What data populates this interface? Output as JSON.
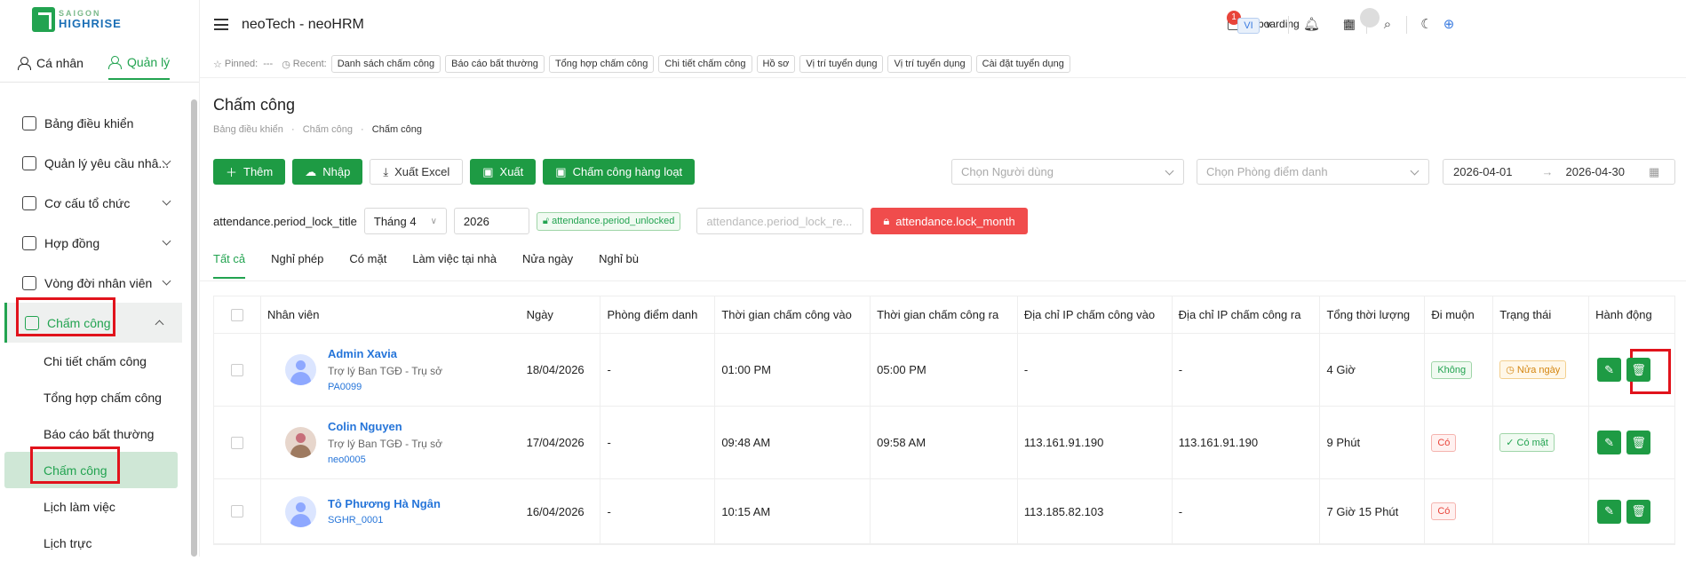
{
  "brand": {
    "line1": "SAIGON",
    "line2": "HIGHRISE"
  },
  "sidebar": {
    "user_tabs": [
      {
        "label": "Cá nhân",
        "active": false
      },
      {
        "label": "Quản lý",
        "active": true
      }
    ],
    "menu": [
      {
        "label": "Bảng điều khiển",
        "icon": "home-icon",
        "has_chevron": false
      },
      {
        "label": "Quản lý yêu cầu nhâ...",
        "icon": "checkbox-icon",
        "has_chevron": true
      },
      {
        "label": "Cơ cấu tổ chức",
        "icon": "org-chart-icon",
        "has_chevron": true
      },
      {
        "label": "Hợp đồng",
        "icon": "contract-icon",
        "has_chevron": true
      },
      {
        "label": "Vòng đời nhân viên",
        "icon": "lifecycle-icon",
        "has_chevron": true
      },
      {
        "label": "Chấm công",
        "icon": "attendance-icon",
        "has_chevron": true,
        "active": true
      }
    ],
    "submenu": [
      {
        "label": "Chi tiết chấm công"
      },
      {
        "label": "Tổng hợp chấm công"
      },
      {
        "label": "Báo cáo bất thường"
      },
      {
        "label": "Chấm công",
        "active": true
      },
      {
        "label": "Lịch làm việc"
      },
      {
        "label": "Lịch trực"
      }
    ]
  },
  "header": {
    "title": "neoTech - neoHRM",
    "onboarding": {
      "label": "Onboarding",
      "badge": "1"
    },
    "lang": "VI"
  },
  "pinbar": {
    "pinned_label": "Pinned:",
    "pinned_value": "---",
    "recent_label": "Recent:",
    "recent_items": [
      "Danh sách chấm công",
      "Báo cáo bất thường",
      "Tổng hợp chấm công",
      "Chi tiết chấm công",
      "Hồ sơ",
      "Vị trí tuyển dụng",
      "Vị trí tuyển dụng",
      "Cài đặt tuyển dụng"
    ]
  },
  "page": {
    "title": "Chấm công",
    "breadcrumb": [
      "Bảng điều khiển",
      "Chấm công",
      "Chấm công"
    ]
  },
  "toolbar": {
    "add": "Thêm",
    "import": "Nhập",
    "export_excel": "Xuất Excel",
    "export": "Xuất",
    "bulk": "Chấm công hàng loạt",
    "user_placeholder": "Chọn Người dùng",
    "room_placeholder": "Chọn Phòng điểm danh",
    "date_from": "2026-04-01",
    "date_to": "2026-04-30"
  },
  "lock": {
    "title": "attendance.period_lock_title",
    "month": "Tháng 4",
    "year": "2026",
    "status": "attendance.period_unlocked",
    "reason_placeholder": "attendance.period_lock_re...",
    "lock_button": "attendance.lock_month"
  },
  "tabs": [
    "Tất cả",
    "Nghỉ phép",
    "Có mặt",
    "Làm việc tại nhà",
    "Nửa ngày",
    "Nghỉ bù"
  ],
  "table": {
    "headers": [
      "Nhân viên",
      "Ngày",
      "Phòng điểm danh",
      "Thời gian chấm công vào",
      "Thời gian chấm công ra",
      "Địa chỉ IP chấm công vào",
      "Địa chỉ IP chấm công ra",
      "Tổng thời lượng",
      "Đi muộn",
      "Trạng thái",
      "Hành động"
    ],
    "rows": [
      {
        "name": "Admin Xavia",
        "role": "Trợ lý Ban TGĐ - Trụ sở",
        "code": "PA0099",
        "date": "18/04/2026",
        "room": "-",
        "in": "01:00 PM",
        "out": "05:00 PM",
        "ip_in": "-",
        "ip_out": "-",
        "total": "4 Giờ",
        "late": "Không",
        "status": "Nửa ngày"
      },
      {
        "name": "Colin Nguyen",
        "role": "Trợ lý Ban TGĐ - Trụ sở",
        "code": "neo0005",
        "date": "17/04/2026",
        "room": "-",
        "in": "09:48 AM",
        "out": "09:58 AM",
        "ip_in": "113.161.91.190",
        "ip_out": "113.161.91.190",
        "total": "9 Phút",
        "late": "Có",
        "status": "Có mặt"
      },
      {
        "name": "Tô Phương Hà Ngân",
        "role": "",
        "code": "SGHR_0001",
        "date": "16/04/2026",
        "room": "-",
        "in": "10:15 AM",
        "out": "",
        "ip_in": "113.185.82.103",
        "ip_out": "-",
        "total": "7 Giờ 15 Phút",
        "late": "Có",
        "status": ""
      }
    ]
  }
}
